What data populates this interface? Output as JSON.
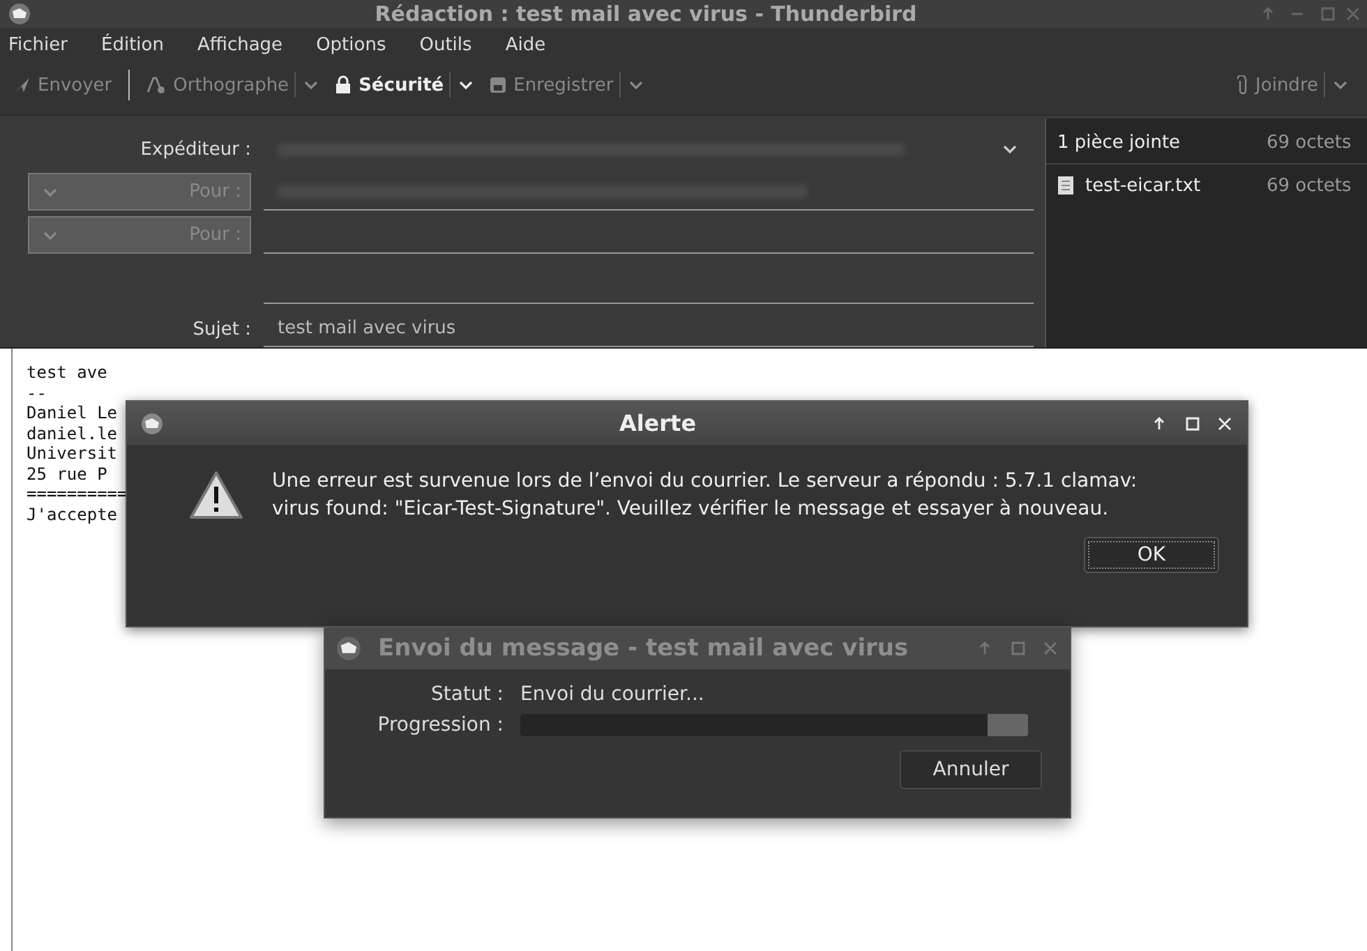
{
  "window": {
    "title": "Rédaction : test mail avec virus - Thunderbird"
  },
  "menu": [
    {
      "label": "Fichier"
    },
    {
      "label": "Édition"
    },
    {
      "label": "Affichage"
    },
    {
      "label": "Options"
    },
    {
      "label": "Outils"
    },
    {
      "label": "Aide"
    }
  ],
  "toolbar": [
    {
      "kind": "send",
      "label": "Envoyer",
      "disabled": true,
      "dropdown": false
    },
    {
      "kind": "spell",
      "label": "Orthographe",
      "disabled": true,
      "dropdown": true
    },
    {
      "kind": "security",
      "label": "Sécurité",
      "disabled": false,
      "dropdown": true
    },
    {
      "kind": "save",
      "label": "Enregistrer",
      "disabled": true,
      "dropdown": true
    }
  ],
  "attach_button": {
    "label": "Joindre",
    "disabled": true
  },
  "header": {
    "from_label": "Expéditeur :",
    "recipients": [
      {
        "label": "Pour :",
        "disabled": true
      },
      {
        "label": "Pour :",
        "disabled": true
      }
    ],
    "subject_label": "Sujet :",
    "subject": "test mail avec virus"
  },
  "attachments": {
    "header": "1 pièce jointe",
    "header_size": "69 octets",
    "items": [
      {
        "name": "test-eicar.txt",
        "size": "69 octets"
      }
    ]
  },
  "body_lines": [
    "test ave",
    "--",
    "Daniel Le",
    "daniel.le",
    "Universit",
    "25 rue P",
    "==========",
    "J'accepte"
  ],
  "alert": {
    "title": "Alerte",
    "message": "Une erreur est survenue lors de l’envoi du courrier. Le serveur a répondu : 5.7.1 clamav: virus found: \"Eicar-Test-Signature\". Veuillez vérifier le message et essayer à nouveau.",
    "button": "OK"
  },
  "progress": {
    "title": "Envoi du message - test mail avec virus",
    "status_label": "Statut :",
    "status": "Envoi du courrier...",
    "progress_label": "Progression :",
    "level": 0.92,
    "button": "Annuler"
  }
}
